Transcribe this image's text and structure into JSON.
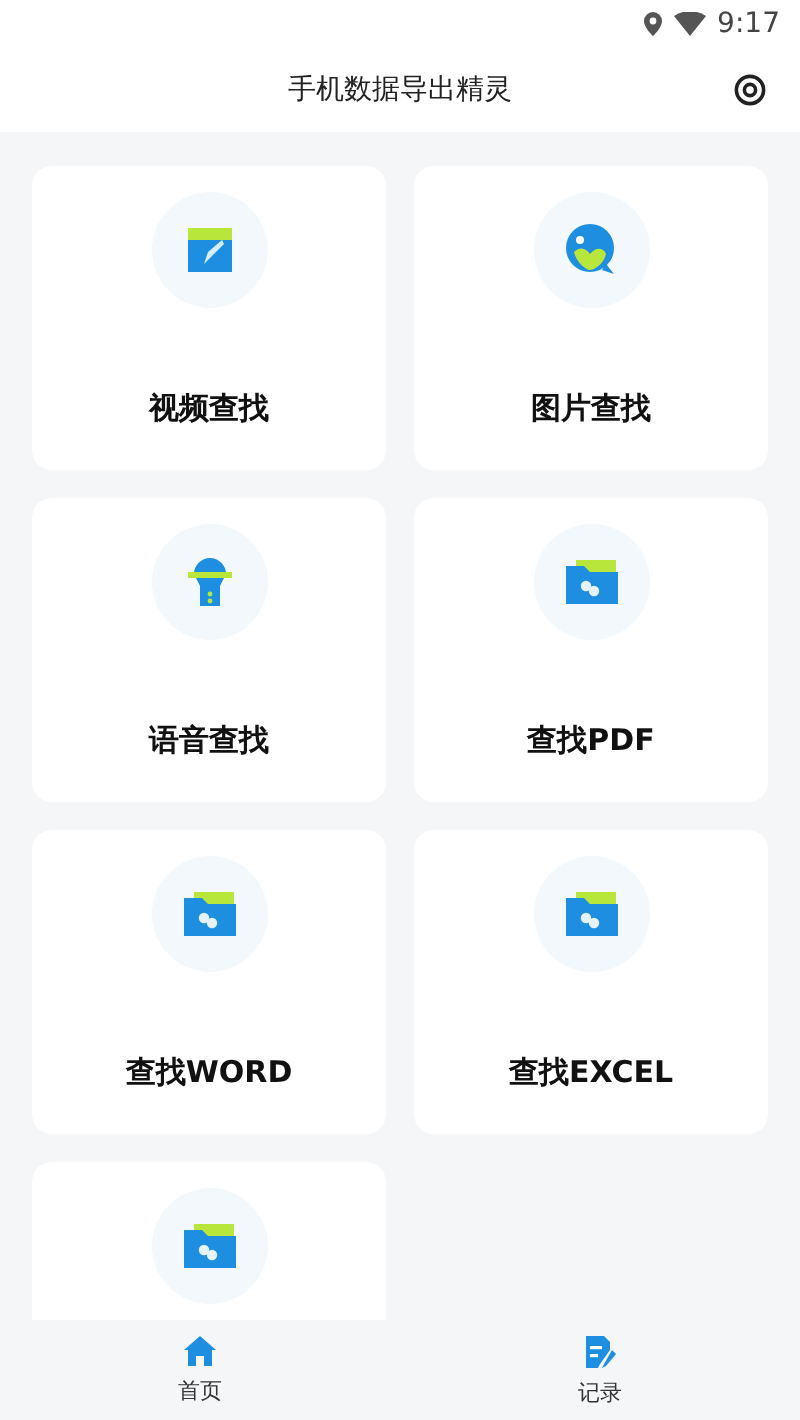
{
  "status_bar": {
    "time": "9:17"
  },
  "header": {
    "title": "手机数据导出精灵"
  },
  "items": [
    {
      "kind": "video",
      "label": "视频查找"
    },
    {
      "kind": "image",
      "label": "图片查找"
    },
    {
      "kind": "voice",
      "label": "语音查找"
    },
    {
      "kind": "folder",
      "label": "查找PDF"
    },
    {
      "kind": "folder",
      "label": "查找WORD"
    },
    {
      "kind": "folder",
      "label": "查找EXCEL"
    },
    {
      "kind": "folder"
    }
  ],
  "bottom_nav": [
    {
      "kind": "home",
      "label": "首页"
    },
    {
      "kind": "record",
      "label": "记录"
    }
  ]
}
